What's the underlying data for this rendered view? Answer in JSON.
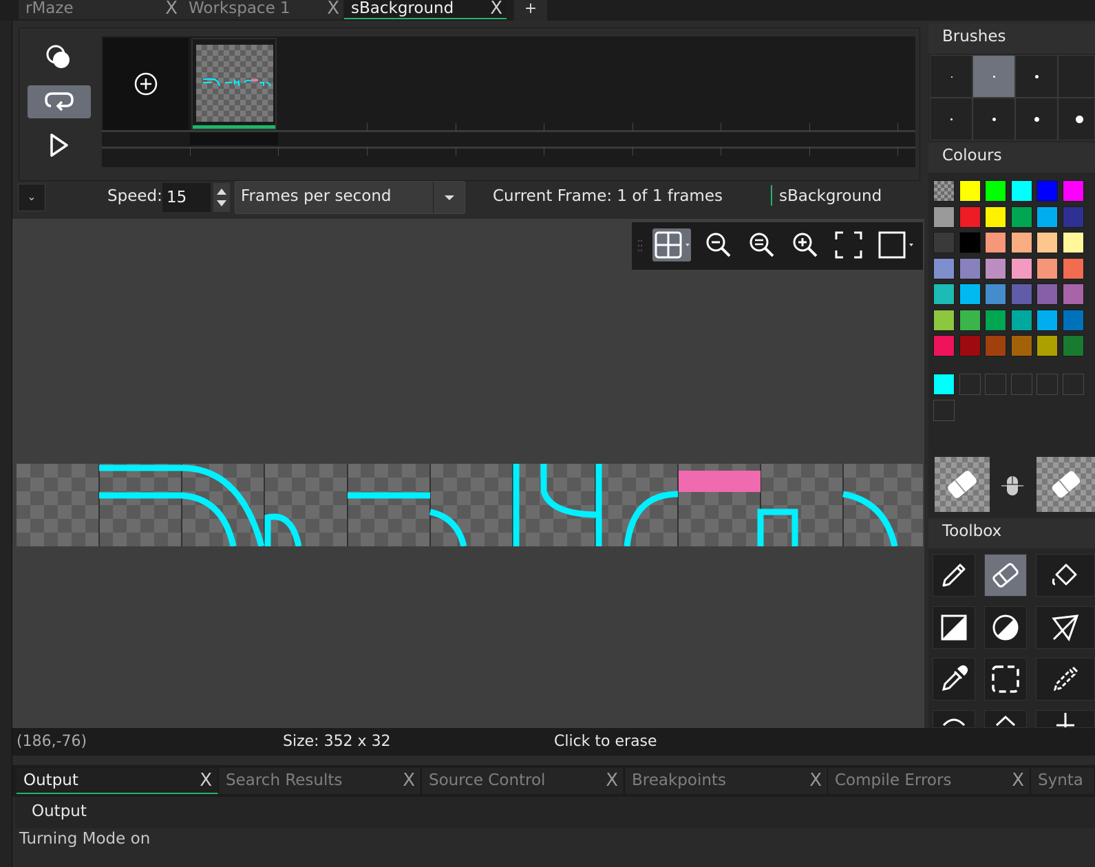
{
  "tabs": [
    {
      "label": "rMaze",
      "active": false
    },
    {
      "label": "Workspace 1",
      "active": false
    },
    {
      "label": "sBackground",
      "active": true
    }
  ],
  "add_tab_label": "+",
  "frames": {
    "speed_label": "Speed:",
    "speed_value": "15",
    "speed_unit": "Frames per second",
    "current_frame": "Current Frame:  1 of 1 frames",
    "sprite_name": "sBackground"
  },
  "status": {
    "coords": "(186,-76)",
    "size": "Size: 352 x 32",
    "hint": "Click to erase"
  },
  "output_tabs": [
    {
      "label": "Output",
      "active": true
    },
    {
      "label": "Search Results",
      "active": false
    },
    {
      "label": "Source Control",
      "active": false
    },
    {
      "label": "Breakpoints",
      "active": false
    },
    {
      "label": "Compile Errors",
      "active": false
    },
    {
      "label": "Synta",
      "active": false
    }
  ],
  "output": {
    "header": "Output",
    "message": "Turning Mode on"
  },
  "right_panel": {
    "brushes_title": "Brushes",
    "colours_title": "Colours",
    "toolbox_title": "Toolbox",
    "selected_colour": "#00f0ff",
    "palette": [
      [
        "transparent",
        "#ffff00",
        "#00ff00",
        "#00ffff",
        "#0000ff",
        "#ff00ff"
      ],
      [
        "#9a9a9a",
        "#ee1c24",
        "#fff200",
        "#00a651",
        "#00aeef",
        "#2e3192"
      ],
      [
        "#3a3a3a",
        "#000000",
        "#f7977a",
        "#fbad82",
        "#fdc68c",
        "#fff799"
      ],
      [
        "#7f8fce",
        "#8781bd",
        "#bc8dbf",
        "#f49ac1",
        "#f69679",
        "#f26c4f"
      ],
      [
        "#1cbbb4",
        "#00b9f1",
        "#448ccb",
        "#605ca8",
        "#8560a8",
        "#a864a8"
      ],
      [
        "#8dc63f",
        "#39b54a",
        "#00a651",
        "#00a99d",
        "#00aeef",
        "#0072bc"
      ],
      [
        "#ed145b",
        "#9e0b0f",
        "#a0410d",
        "#a36209",
        "#aba000",
        "#197b30"
      ]
    ],
    "recent_colours": [
      "#00ffff",
      "empty",
      "empty",
      "empty",
      "empty",
      "empty",
      "empty"
    ]
  }
}
